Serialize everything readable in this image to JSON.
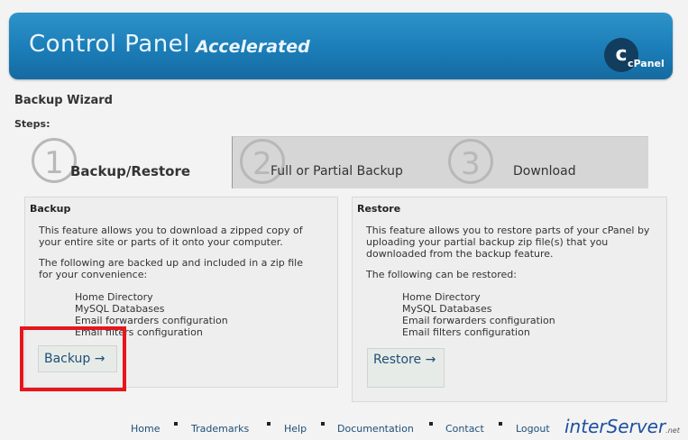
{
  "header": {
    "title": "Control Panel",
    "subtitle": "Accelerated",
    "logo_text": "cPanel"
  },
  "wizard": {
    "title": "Backup Wizard",
    "steps_label": "Steps:"
  },
  "tabs": [
    {
      "number": "1",
      "label": "Backup/Restore"
    },
    {
      "number": "2",
      "label": "Full or Partial Backup"
    },
    {
      "number": "3",
      "label": "Download"
    }
  ],
  "backup": {
    "title": "Backup",
    "text1": "This feature allows you to download a zipped copy of your entire site or parts of it onto your computer.",
    "text2": "The following are backed up and included in a zip file for your convenience:",
    "items": [
      "Home Directory",
      "MySQL Databases",
      "Email forwarders configuration",
      "Email filters configuration"
    ],
    "button": "Backup →"
  },
  "restore": {
    "title": "Restore",
    "text1": "This feature allows you to restore parts of your cPanel by uploading your partial backup zip file(s) that you downloaded from the backup feature.",
    "text2": "The following can be restored:",
    "items": [
      "Home Directory",
      "MySQL Databases",
      "Email forwarders configuration",
      "Email filters configuration"
    ],
    "button": "Restore →"
  },
  "footer": {
    "links": [
      "Home",
      "Trademarks",
      "Help",
      "Documentation",
      "Contact",
      "Logout"
    ],
    "brand": "interServer",
    "brand_suffix": ".net"
  },
  "colors": {
    "header": "#1b7db8",
    "highlight": "#e6161c",
    "link": "#1d4f78"
  }
}
